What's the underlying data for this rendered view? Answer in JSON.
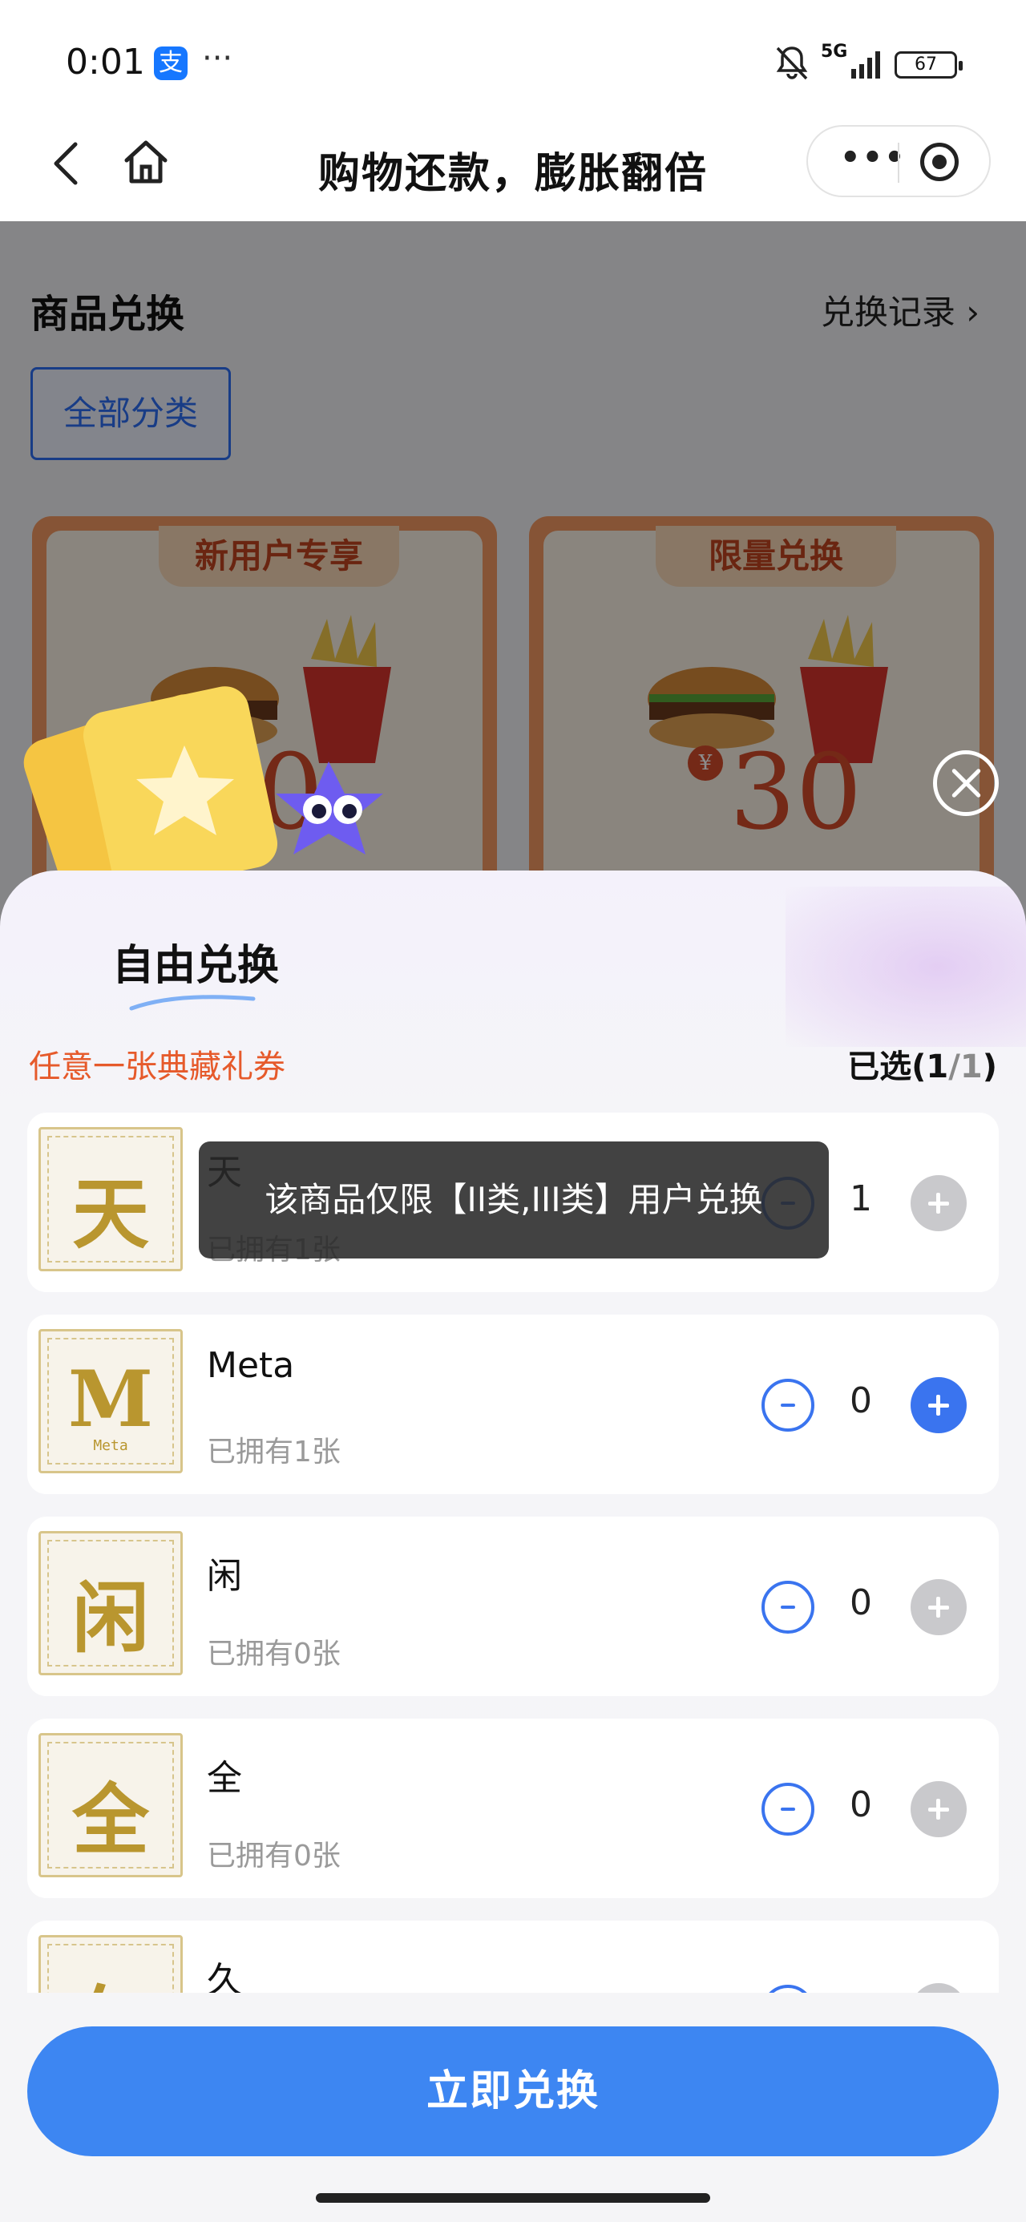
{
  "status_bar": {
    "time": "0:01",
    "app_glyph": "支",
    "more": "···",
    "network": "5G",
    "battery": "67"
  },
  "nav": {
    "title": "购物还款，膨胀翻倍",
    "more": "•••"
  },
  "background_page": {
    "section_title": "商品兑换",
    "record_link": "兑换记录 ›",
    "filter_label": "全部分类",
    "coupons": [
      {
        "tag": "新用户专享",
        "price": "30"
      },
      {
        "tag": "限量兑换",
        "price": "30",
        "currency": "¥"
      }
    ]
  },
  "sheet": {
    "title": "自由兑换",
    "section_label": "任意一张典藏礼券",
    "selected_prefix": "已选(",
    "selected_count": "1",
    "selected_sep": "/",
    "selected_total": "1",
    "selected_suffix": ")",
    "items": [
      {
        "name": "天",
        "glyph": "天",
        "glyph_sub": "",
        "owned": "已拥有1张",
        "qty": "1"
      },
      {
        "name": "Meta",
        "glyph": "M",
        "glyph_sub": "Meta",
        "owned": "已拥有1张",
        "qty": "0"
      },
      {
        "name": "闲",
        "glyph": "闲",
        "glyph_sub": "",
        "owned": "已拥有0张",
        "qty": "0"
      },
      {
        "name": "全",
        "glyph": "全",
        "glyph_sub": "",
        "owned": "已拥有0张",
        "qty": "0"
      },
      {
        "name": "久",
        "glyph": "久",
        "glyph_sub": "",
        "owned": "",
        "qty": ""
      }
    ],
    "toast": "该商品仅限【II类,III类】用户兑换",
    "cta": "立即兑换"
  },
  "colors": {
    "accent": "#3d86f2",
    "section_label": "#e65a2b",
    "coupon": "#f59a63"
  }
}
